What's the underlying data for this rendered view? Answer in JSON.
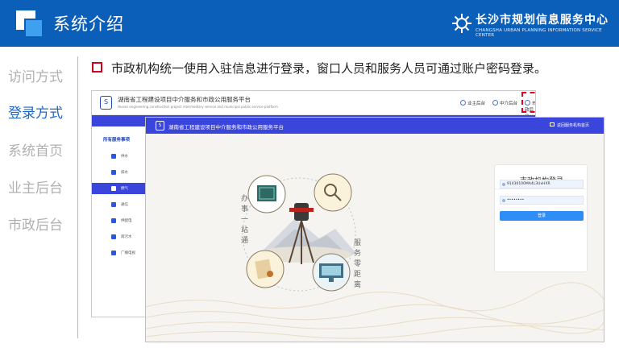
{
  "header": {
    "title": "系统介绍",
    "brand_cn": "长沙市规划信息服务中心",
    "brand_en": "CHANGSHA URBAN PLANNING INFORMATION SERVICE CENTER"
  },
  "nav": {
    "items": [
      {
        "label": "访问方式",
        "active": false
      },
      {
        "label": "登录方式",
        "active": true
      },
      {
        "label": "系统首页",
        "active": false
      },
      {
        "label": "业主后台",
        "active": false
      },
      {
        "label": "市政后台",
        "active": false
      }
    ]
  },
  "content": {
    "bullet_text": "市政机构统一使用入驻信息进行登录，窗口人员和服务人员可通过账户密码登录。"
  },
  "back_screen": {
    "logo_glyph": "S",
    "title": "湖南省工程建设项目中介服务和市政公用服务平台",
    "subtitle": "Hunan engineering construction project intermediary service and municipal public service platform",
    "top_links": [
      "业主后台",
      "中介后台",
      "市政后台"
    ],
    "side_header": "所有服务事项",
    "side_items": [
      {
        "label": "供水",
        "active": false
      },
      {
        "label": "排水",
        "active": false
      },
      {
        "label": "燃气",
        "active": true
      },
      {
        "label": "通信",
        "active": false
      },
      {
        "label": "供配电",
        "active": false
      },
      {
        "label": "雨污水",
        "active": false
      },
      {
        "label": "广播电视",
        "active": false
      }
    ]
  },
  "front_screen": {
    "logo_glyph": "S",
    "title": "湖南省工程建设项目中介服务和市政公用服务平台",
    "top_link": "返回服务机构首页",
    "left_slogan": "办事一站通",
    "right_slogan": "服务零距离",
    "login": {
      "title": "市政机构登录",
      "username_value": "91430100MA4L3UxHXR",
      "password_value": "••••••••",
      "button_label": "登录"
    }
  },
  "colors": {
    "header_blue": "#0c5fb8",
    "platform_blue": "#3a45dc",
    "nav_active": "#1f66c7",
    "nav_inactive": "#b0b0b0",
    "accent_red": "#d0021b"
  }
}
